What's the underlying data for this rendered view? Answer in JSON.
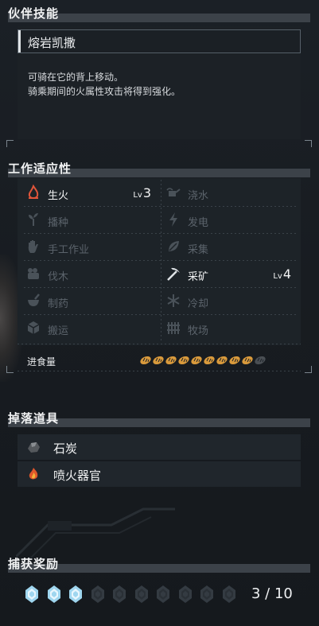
{
  "partner_skill": {
    "header": "伙伴技能",
    "name": "熔岩凯撒",
    "description_line1": "可骑在它的背上移动。",
    "description_line2": "骑乘期间的火属性攻击将得到强化。"
  },
  "work_suitability": {
    "header": "工作适应性",
    "lv_prefix": "Lv",
    "items": [
      {
        "label": "生火",
        "icon": "fire-icon",
        "active": true,
        "level": "3"
      },
      {
        "label": "浇水",
        "icon": "watering-can-icon",
        "active": false,
        "level": ""
      },
      {
        "label": "播种",
        "icon": "sprout-icon",
        "active": false,
        "level": ""
      },
      {
        "label": "发电",
        "icon": "lightning-icon",
        "active": false,
        "level": ""
      },
      {
        "label": "手工作业",
        "icon": "hand-icon",
        "active": false,
        "level": ""
      },
      {
        "label": "采集",
        "icon": "leaf-icon",
        "active": false,
        "level": ""
      },
      {
        "label": "伐木",
        "icon": "logs-icon",
        "active": false,
        "level": ""
      },
      {
        "label": "采矿",
        "icon": "pickaxe-icon",
        "active": true,
        "level": "4"
      },
      {
        "label": "制药",
        "icon": "mortar-icon",
        "active": false,
        "level": ""
      },
      {
        "label": "冷却",
        "icon": "snowflake-icon",
        "active": false,
        "level": ""
      },
      {
        "label": "搬运",
        "icon": "boxes-icon",
        "active": false,
        "level": ""
      },
      {
        "label": "牧场",
        "icon": "fence-icon",
        "active": false,
        "level": ""
      }
    ],
    "food_label": "进食量",
    "food_filled": 9,
    "food_total": 10
  },
  "drops": {
    "header": "掉落道具",
    "items": [
      {
        "label": "石炭",
        "icon": "coal-icon"
      },
      {
        "label": "喷火器官",
        "icon": "flame-organ-icon"
      }
    ]
  },
  "capture_reward": {
    "header": "捕获奖励",
    "filled": 3,
    "total": 10,
    "count_text": "3 / 10"
  },
  "colors": {
    "accent_fire": "#e0553a",
    "food_bread": "#d99a3c",
    "reward_diamond": "#9fd6ef"
  }
}
